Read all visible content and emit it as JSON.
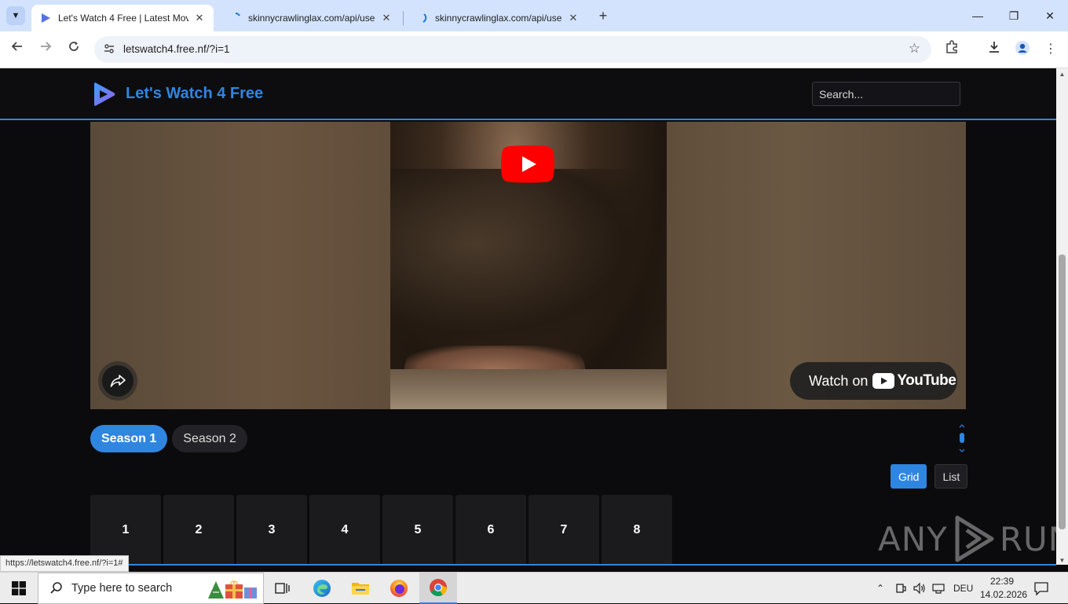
{
  "browser": {
    "tabs": [
      {
        "title": "Let's Watch 4 Free | Latest Mov",
        "active": true
      },
      {
        "title": "skinnycrawlinglax.com/api/user",
        "active": false
      },
      {
        "title": "skinnycrawlinglax.com/api/user",
        "active": false
      }
    ],
    "url": "letswatch4.free.nf/?i=1",
    "status_url": "https://letswatch4.free.nf/?i=1#"
  },
  "site": {
    "title": "Let's Watch 4 Free",
    "search_placeholder": "Search..."
  },
  "video": {
    "watch_on_label": "Watch on",
    "youtube_word": "YouTube"
  },
  "seasons": [
    {
      "label": "Season 1",
      "active": true
    },
    {
      "label": "Season 2",
      "active": false
    }
  ],
  "view_toggle": {
    "grid_label": "Grid",
    "list_label": "List",
    "active": "Grid"
  },
  "episodes": [
    "1",
    "2",
    "3",
    "4",
    "5",
    "6",
    "7",
    "8"
  ],
  "watermark": {
    "left": "ANY",
    "right": "RUN"
  },
  "taskbar": {
    "search_placeholder": "Type here to search",
    "language": "DEU",
    "time": "22:39",
    "date": "14.02.2026"
  },
  "colors": {
    "accent": "#2f86e0",
    "youtube_red": "#ff0000",
    "page_bg": "#0b0b0d"
  }
}
